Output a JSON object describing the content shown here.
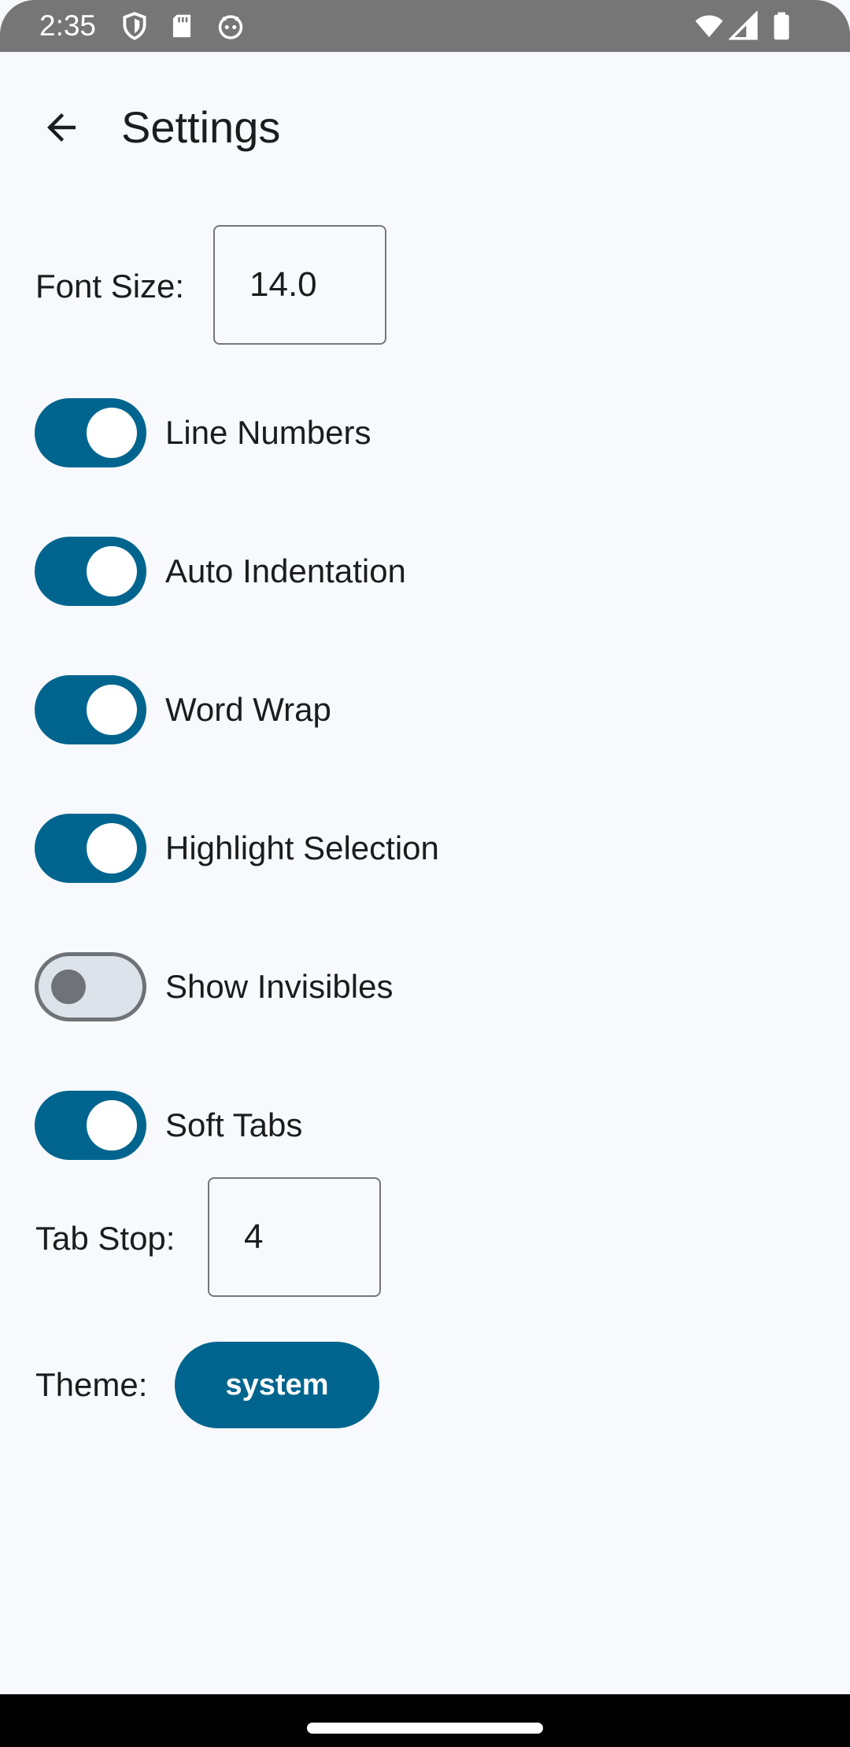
{
  "status_bar": {
    "time": "2:35",
    "left_icons": [
      "shield-icon",
      "sd-card-icon",
      "android-debug-icon"
    ],
    "right_icons": [
      "wifi-icon",
      "cell-signal-icon",
      "battery-icon"
    ]
  },
  "app_bar": {
    "title": "Settings",
    "back_icon": "arrow-back-icon"
  },
  "settings": {
    "font_size": {
      "label": "Font Size:",
      "value": "14.0"
    },
    "toggles": [
      {
        "label": "Line Numbers",
        "enabled": true
      },
      {
        "label": "Auto Indentation",
        "enabled": true
      },
      {
        "label": "Word Wrap",
        "enabled": true
      },
      {
        "label": "Highlight Selection",
        "enabled": true
      },
      {
        "label": "Show Invisibles",
        "enabled": false
      },
      {
        "label": "Soft Tabs",
        "enabled": true
      }
    ],
    "tab_stop": {
      "label": "Tab Stop:",
      "value": "4"
    },
    "theme": {
      "label": "Theme:",
      "value": "system"
    }
  },
  "colors": {
    "accent": "#00658e",
    "background": "#f8f9fd",
    "status_bar": "#767676",
    "switch_off_track": "#dde3ea",
    "switch_off_outline": "#6f7378"
  }
}
